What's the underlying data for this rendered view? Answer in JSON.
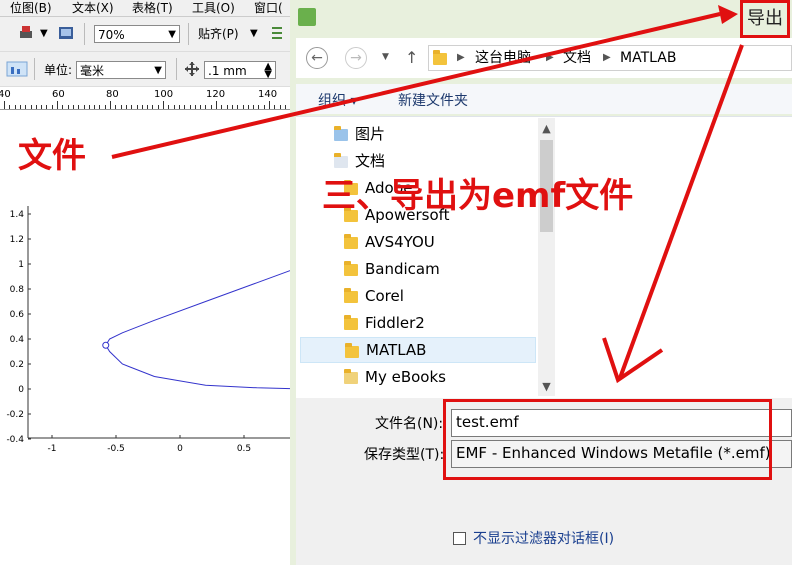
{
  "editor": {
    "menu": [
      "位图(B)",
      "文本(X)",
      "表格(T)",
      "工具(O)",
      "窗口("
    ],
    "zoom": "70%",
    "snap_label": "贴齐(P)",
    "unit_label": "单位:",
    "unit_value": "毫米",
    "nudge_value": ".1 mm",
    "ruler_labels": [
      "40",
      "60",
      "80",
      "100",
      "120",
      "140"
    ]
  },
  "annotations": {
    "file_label": "文件",
    "step_label": "三、导出为emf文件",
    "color": "#e01010"
  },
  "dialog": {
    "export_button": "导出",
    "breadcrumb": [
      "这台电脑",
      "文档",
      "MATLAB"
    ],
    "organize": "组织 ▾",
    "new_folder": "新建文件夹",
    "tree": [
      {
        "label": "图片",
        "icon": "pictures-folder-icon"
      },
      {
        "label": "文档",
        "icon": "documents-folder-icon"
      },
      {
        "label": "Adobe",
        "icon": "folder-icon"
      },
      {
        "label": "Apowersoft",
        "icon": "folder-icon"
      },
      {
        "label": "AVS4YOU",
        "icon": "folder-icon"
      },
      {
        "label": "Bandicam",
        "icon": "folder-icon"
      },
      {
        "label": "Corel",
        "icon": "folder-icon"
      },
      {
        "label": "Fiddler2",
        "icon": "folder-icon"
      },
      {
        "label": "MATLAB",
        "icon": "folder-icon"
      },
      {
        "label": "My eBooks",
        "icon": "ebooks-folder-icon"
      }
    ],
    "filename_label": "文件名(N):",
    "filename_value": "test.emf",
    "filetype_label": "保存类型(T):",
    "filetype_value": "EMF - Enhanced Windows Metafile (*.emf)",
    "no_filter_label": "不显示过滤器对话框(I)"
  },
  "chart_data": {
    "type": "line",
    "x": [
      1.0,
      0.6,
      0.2,
      -0.2,
      -0.45,
      -0.55,
      -0.58,
      -0.55,
      -0.45,
      -0.2,
      0.2,
      0.6,
      1.0
    ],
    "y": [
      1.0,
      0.85,
      0.7,
      0.55,
      0.45,
      0.4,
      0.35,
      0.3,
      0.2,
      0.1,
      0.03,
      0.01,
      0.0
    ],
    "xlim": [
      -1.2,
      0.8
    ],
    "ylim": [
      -0.4,
      1.4
    ],
    "x_ticks": [
      "-1",
      "-0.5",
      "0",
      "0.5"
    ],
    "y_ticks": [
      "1.4",
      "1.2",
      "1",
      "0.8",
      "0.6",
      "0.4",
      "0.2",
      "0",
      "-0.2",
      "-0.4"
    ],
    "series_color": "#3333cc"
  }
}
